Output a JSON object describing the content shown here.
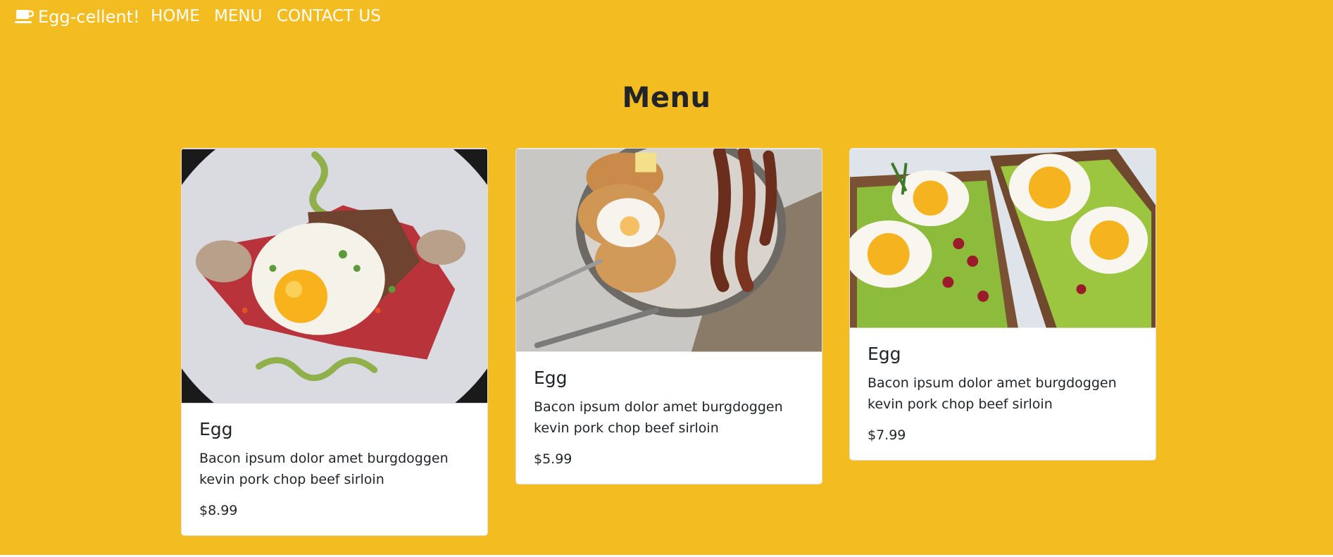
{
  "navbar": {
    "brand_label": "Egg-cellent!",
    "brand_icon": "coffee-cup-icon",
    "links": [
      {
        "label": "HOME"
      },
      {
        "label": "MENU"
      },
      {
        "label": "CONTACT US"
      }
    ]
  },
  "main": {
    "title": "Menu",
    "cards": [
      {
        "image_subject": "fried egg on chilaquiles",
        "title": "Egg",
        "description": "Bacon ipsum dolor amet burgdoggen kevin pork chop beef sirloin",
        "price": "$8.99"
      },
      {
        "image_subject": "pancakes with poached egg and bacon",
        "title": "Egg",
        "description": "Bacon ipsum dolor amet burgdoggen kevin pork chop beef sirloin",
        "price": "$5.99"
      },
      {
        "image_subject": "boiled eggs on avocado toast",
        "title": "Egg",
        "description": "Bacon ipsum dolor amet burgdoggen kevin pork chop beef sirloin",
        "price": "$7.99"
      }
    ]
  },
  "colors": {
    "background": "#f3bd22",
    "nav_text": "#ffffff",
    "card_background": "#ffffff",
    "text": "#212529"
  }
}
